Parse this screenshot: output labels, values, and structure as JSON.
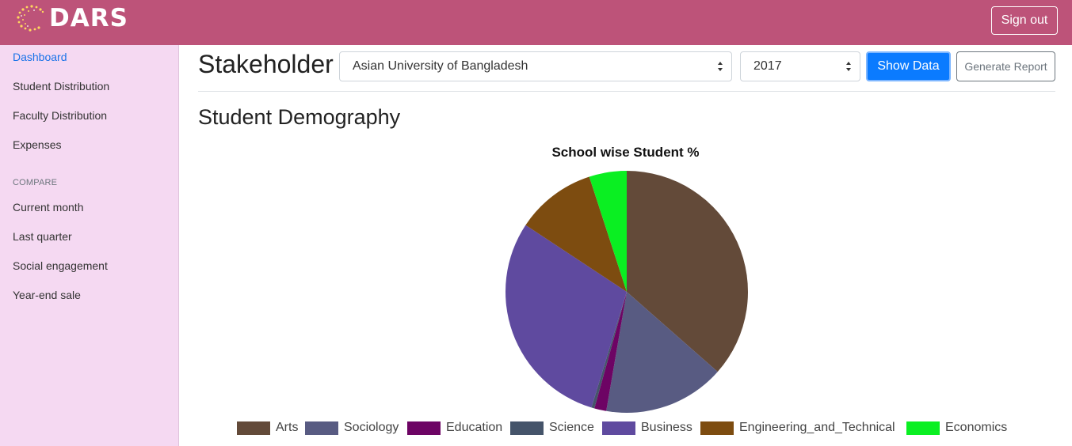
{
  "app": {
    "brand": "DARS",
    "sign_out": "Sign out"
  },
  "sidebar": {
    "items": [
      {
        "label": "Dashboard",
        "active": true
      },
      {
        "label": "Student Distribution"
      },
      {
        "label": "Faculty Distribution"
      },
      {
        "label": "Expenses"
      }
    ],
    "compare_heading": "COMPARE",
    "compare_items": [
      {
        "label": "Current month"
      },
      {
        "label": "Last quarter"
      },
      {
        "label": "Social engagement"
      },
      {
        "label": "Year-end sale"
      }
    ]
  },
  "toolbar": {
    "title": "Stakeholder",
    "university_select": "Asian University of Bangladesh",
    "year_select": "2017",
    "show_data": "Show Data",
    "generate_report": "Generate Report"
  },
  "section": {
    "title": "Student Demography"
  },
  "colors": {
    "header": "#bd5379",
    "sidebar": "#f5d9f2",
    "primary": "#0b7bff"
  },
  "chart_data": {
    "type": "pie",
    "title": "School wise Student %",
    "legend_position": "bottom",
    "categories": [
      "Arts",
      "Sociology",
      "Education",
      "Science",
      "Business",
      "Engineering_and_Technical",
      "Economics"
    ],
    "values": [
      36.5,
      16.2,
      1.6,
      0.4,
      29.6,
      10.7,
      5.0
    ],
    "colors": [
      "#634a39",
      "#585b82",
      "#6d0464",
      "#45546a",
      "#5f4a9f",
      "#7d4c10",
      "#0aef22"
    ]
  }
}
